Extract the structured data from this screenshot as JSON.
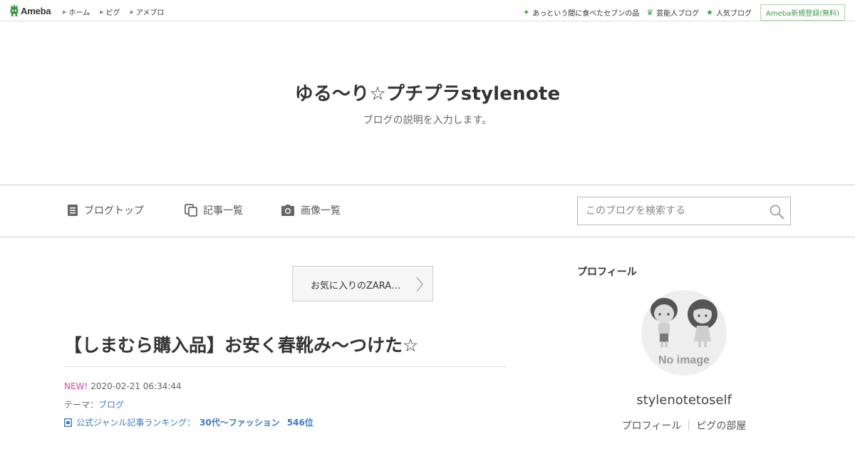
{
  "topbar": {
    "logo_text": "Ameba",
    "nav": [
      {
        "label": "ホーム"
      },
      {
        "label": "ピグ"
      },
      {
        "label": "アメブロ"
      }
    ],
    "right_links": [
      {
        "label": "あっという間に食べたセブンの品",
        "icon": "sparkle-icon"
      },
      {
        "label": "芸能人ブログ",
        "icon": "crown-icon"
      },
      {
        "label": "人気ブログ",
        "icon": "star-icon"
      }
    ],
    "register_label": "Ameba新規登録(無料)",
    "accent_color": "#3a9a47"
  },
  "header": {
    "title": "ゆる〜り☆プチプラstylenote",
    "description": "ブログの説明を入力します。"
  },
  "nav": {
    "items": [
      {
        "label": "ブログトップ",
        "icon": "document-icon"
      },
      {
        "label": "記事一覧",
        "icon": "copy-icon"
      },
      {
        "label": "画像一覧",
        "icon": "camera-icon"
      }
    ],
    "search_placeholder": "このブログを検索する"
  },
  "main": {
    "prev_entry_label": "お気に入りのZARA…",
    "entry_title": "【しまむら購入品】お安く春靴み〜つけた☆",
    "new_badge": "NEW!",
    "date": "2020-02-21 06:34:44",
    "theme_prefix": "テーマ：",
    "theme_link": "ブログ",
    "ranking_label": "公式ジャンル記事ランキング：",
    "ranking_genre": "30代〜ファッション",
    "ranking_position": "546位"
  },
  "sidebar": {
    "heading": "プロフィール",
    "avatar_text": "No image",
    "name": "stylenotetoself",
    "links": [
      {
        "label": "プロフィール"
      },
      {
        "label": "ピグの部屋"
      }
    ]
  }
}
